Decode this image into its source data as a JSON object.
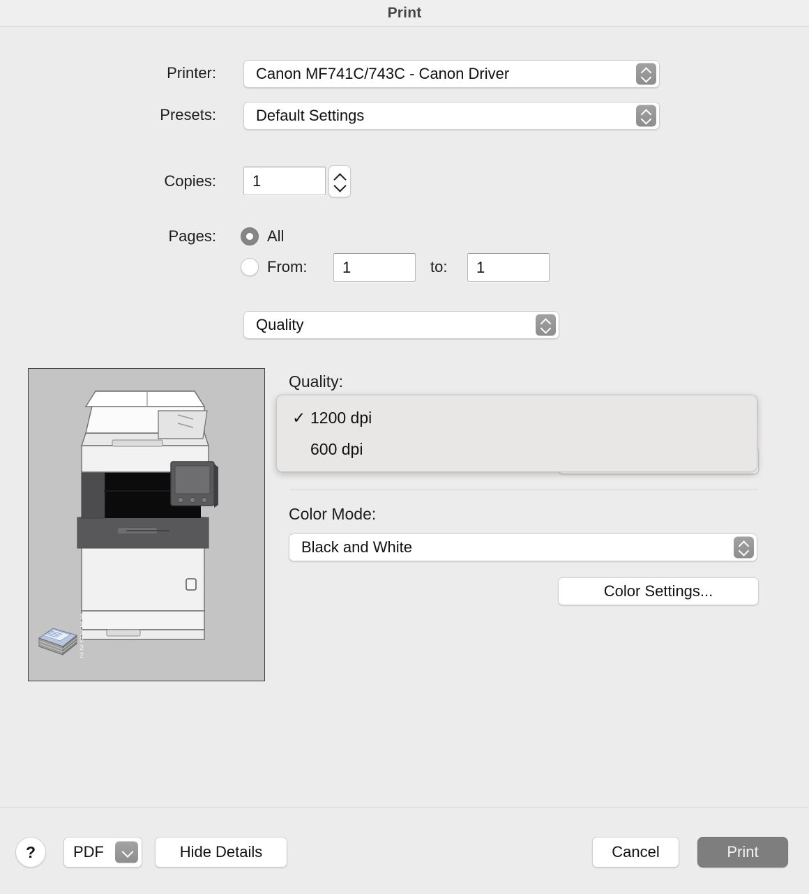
{
  "window": {
    "title": "Print"
  },
  "form": {
    "printer_label": "Printer:",
    "printer_value": "Canon MF741C/743C - Canon Driver",
    "presets_label": "Presets:",
    "presets_value": "Default Settings",
    "copies_label": "Copies:",
    "copies_value": "1",
    "pages_label": "Pages:",
    "pages_all_label": "All",
    "pages_from_label": "From:",
    "pages_from_value": "1",
    "pages_to_label": "to:",
    "pages_to_value": "1",
    "pane_value": "Quality"
  },
  "quality_section": {
    "quality_label": "Quality:",
    "menu_items": [
      {
        "label": "1200 dpi",
        "checked": true,
        "check_glyph": "✓"
      },
      {
        "label": "600 dpi",
        "checked": false,
        "check_glyph": ""
      }
    ],
    "color_mode_label": "Color Mode:",
    "color_mode_value": "Black and White",
    "color_settings_label": "Color Settings..."
  },
  "preview": {
    "stack_numbers": "1\n1\n1\n2\n2\n2"
  },
  "bottom_bar": {
    "help_label": "?",
    "pdf_label": "PDF",
    "hide_details_label": "Hide Details",
    "cancel_label": "Cancel",
    "print_label": "Print"
  },
  "colors": {
    "window_bg": "#ececec",
    "titlebar_bg": "#f0efef",
    "menu_bg": "#e9e7e5",
    "preview_bg": "#c4c4c4",
    "print_button_bg": "#7e7e7e",
    "stepper_gray": "#959595",
    "radio_selected": "#858585"
  }
}
